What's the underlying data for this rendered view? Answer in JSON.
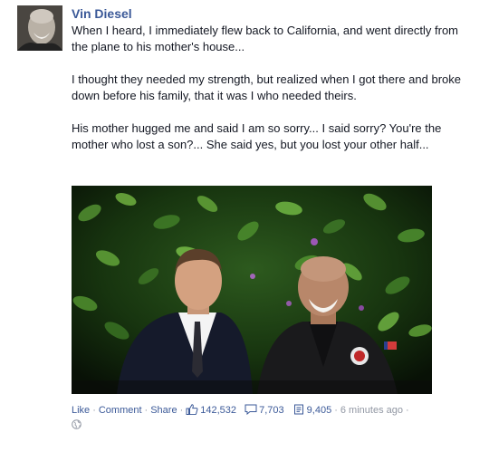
{
  "post": {
    "author": "Vin Diesel",
    "paragraphs": [
      "When I heard, I immediately flew back to California, and went directly from the plane to his mother's house...",
      "I thought they needed my strength, but realized when I got there and broke down before his family, that it was I who needed theirs.",
      "His mother hugged me and said I am so sorry... I said sorry? You're the mother who lost a son?... She said yes, but you lost your other half..."
    ]
  },
  "footer": {
    "like": "Like",
    "comment": "Comment",
    "share": "Share",
    "likes_count": "142,532",
    "comments_count": "7,703",
    "shares_count": "9,405",
    "timestamp": "6 minutes ago",
    "separator": "·"
  },
  "icons": {
    "like": "thumbs-up-icon",
    "comment": "comment-icon",
    "share": "share-icon",
    "privacy": "globe-icon"
  },
  "colors": {
    "link": "#3b5998",
    "text": "#141823",
    "muted": "#9197a3"
  }
}
